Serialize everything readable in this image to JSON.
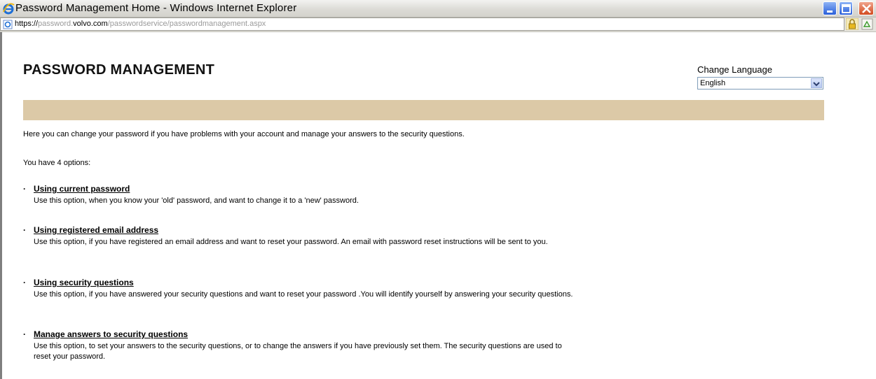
{
  "window": {
    "title": "Password Management Home - Windows Internet Explorer"
  },
  "address_bar": {
    "url_scheme": "https://",
    "url_sub": "password.",
    "url_domain": "volvo.com",
    "url_path": "/passwordservice/passwordmanagement.aspx"
  },
  "header": {
    "title": "PASSWORD MANAGEMENT",
    "language_label": "Change Language",
    "language_selected": "English"
  },
  "content": {
    "intro": "Here you can change your password if you have problems with your account and manage your answers to the security questions.",
    "options_count_text": "You have 4 options:",
    "options": [
      {
        "title": "Using current password",
        "description": "Use this option, when you know your 'old' password, and want to change it to a 'new' password."
      },
      {
        "title": "Using registered email address",
        "description": "Use this option, if you have registered an email address and want to reset your password. An email with password reset instructions will be sent to you."
      },
      {
        "title": "Using security questions",
        "description": "Use this option, if you have answered your security questions and want to reset your password .You will identify yourself by answering your security questions."
      },
      {
        "title": "Manage answers to security questions",
        "description": "Use this option, to set your answers to the security questions, or to change the answers if you have previously set them. The security questions are used to reset your password."
      }
    ]
  },
  "colors": {
    "band": "#dcc9a7",
    "close_button": "#d24a1f",
    "window_buttons": "#2a5fd9"
  },
  "icons": [
    "ie-logo-icon",
    "page-icon",
    "lock-icon",
    "compatibility-icon",
    "minimize-icon",
    "maximize-icon",
    "close-icon",
    "dropdown-arrow-icon"
  ]
}
